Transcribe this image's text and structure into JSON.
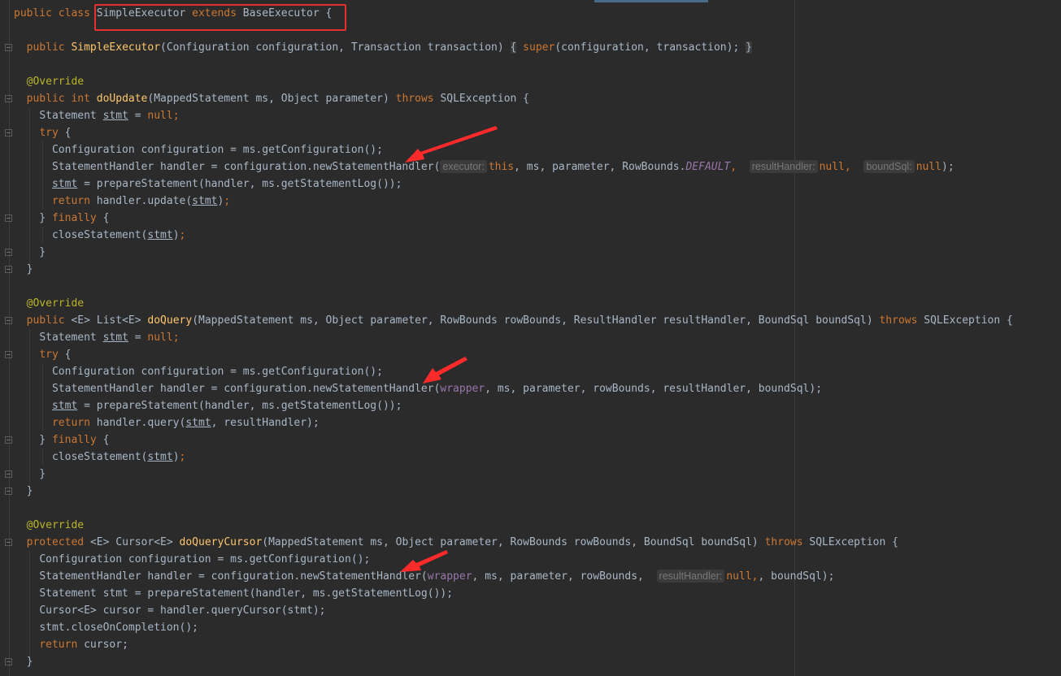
{
  "editor": {
    "theme_colors": {
      "background": "#2b2b2b",
      "text": "#a9b7c6",
      "keyword": "#cc7832",
      "method": "#ffc66d",
      "annotation": "#bbb529",
      "field": "#9876aa",
      "highlight_box": "#e53030",
      "arrow": "#ff2020"
    },
    "class_decl": {
      "modifiers": "public class ",
      "name": "SimpleExecutor",
      "extends_kw": "extends",
      "parent": "BaseExecutor",
      "brace": "{"
    },
    "constructor": {
      "modifier": "public",
      "name": "SimpleExecutor",
      "params": "Configuration configuration, Transaction transaction)",
      "body_kw": "super",
      "body_args": "(configuration, transaction);"
    },
    "annotation": "@Override",
    "do_update": {
      "signature_kw": "public int",
      "name": "doUpdate",
      "params": "(MappedStatement ms, Object parameter)",
      "throws_kw": "throws",
      "exception": "SQLException {",
      "lines": {
        "stmt_decl_type": "Statement",
        "stmt_var": "stmt",
        "null_kw": "null",
        "try_kw": "try",
        "config_line": "Configuration configuration = ms.getConfiguration();",
        "handler_prefix": "StatementHandler handler = configuration.newStatementHandler(",
        "hint_executor": "executor:",
        "this_kw": "this",
        "args_mid": ", ms, parameter, RowBounds.",
        "default_const": "DEFAULT",
        "hint_result_handler": "resultHandler:",
        "hint_bound_sql": "boundSql:",
        "prepare_suffix": " = prepareStatement(handler, ms.getStatementLog());",
        "return_kw": "return",
        "return_expr": " handler.update(",
        "finally_kw": "finally",
        "close_stmt": "closeStatement("
      }
    },
    "do_query": {
      "modifier": "public",
      "generic": "<E>",
      "return_type": "List<E>",
      "name": "doQuery",
      "params": "(MappedStatement ms, Object parameter, RowBounds rowBounds, ResultHandler resultHandler, BoundSql boundSql)",
      "throws_kw": "throws",
      "exception": "SQLException {",
      "wrapper_field": "wrapper",
      "handler_args": ", ms, parameter, rowBounds, resultHandler, boundSql);",
      "return_expr": " handler.query(",
      "return_tail": ", resultHandler);"
    },
    "do_query_cursor": {
      "modifier": "protected",
      "generic": "<E>",
      "return_type": "Cursor<E>",
      "name": "doQueryCursor",
      "params": "(MappedStatement ms, Object parameter, RowBounds rowBounds, BoundSql boundSql)",
      "throws_kw": "throws",
      "exception": "SQLException {",
      "config_line": "Configuration configuration = ms.getConfiguration();",
      "handler_prefix": "StatementHandler handler = configuration.newStatementHandler(",
      "wrapper_field": "wrapper",
      "handler_args_1": ", ms, parameter, rowBounds, ",
      "hint_result_handler": "resultHandler:",
      "handler_args_2": ", boundSql);",
      "prepare_line": "Statement stmt = prepareStatement(handler, ms.getStatementLog());",
      "cursor_line": "Cursor<E> cursor = handler.queryCursor(stmt);",
      "close_line": "stmt.closeOnCompletion();",
      "return_kw": "return",
      "return_expr": " cursor;"
    }
  }
}
